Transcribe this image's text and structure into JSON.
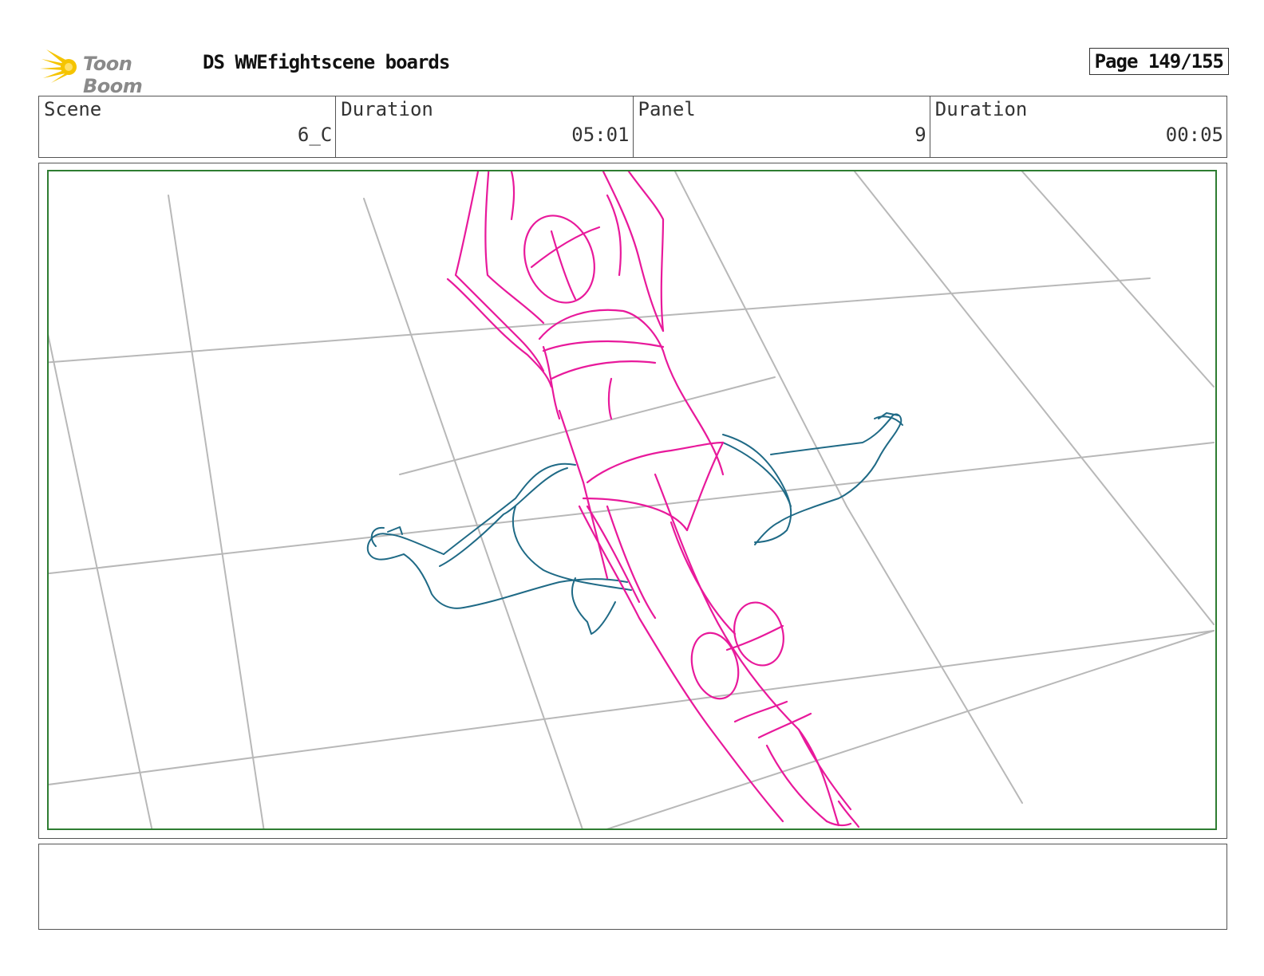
{
  "header": {
    "logo_text": "Toon Boom",
    "title": "DS WWEfightscene boards",
    "page_label": "Page 149/155"
  },
  "info": {
    "scene_label": "Scene",
    "scene_value": "6_C",
    "scene_duration_label": "Duration",
    "scene_duration_value": "05:01",
    "panel_label": "Panel",
    "panel_value": "9",
    "panel_duration_label": "Duration",
    "panel_duration_value": "00:05"
  },
  "colors": {
    "grid": "#b8b8b8",
    "figure_top": "#e8199b",
    "figure_bottom": "#1f6a86",
    "safe_frame": "#2e7d32",
    "logo_star": "#f5c400"
  },
  "notes": {
    "text": ""
  }
}
